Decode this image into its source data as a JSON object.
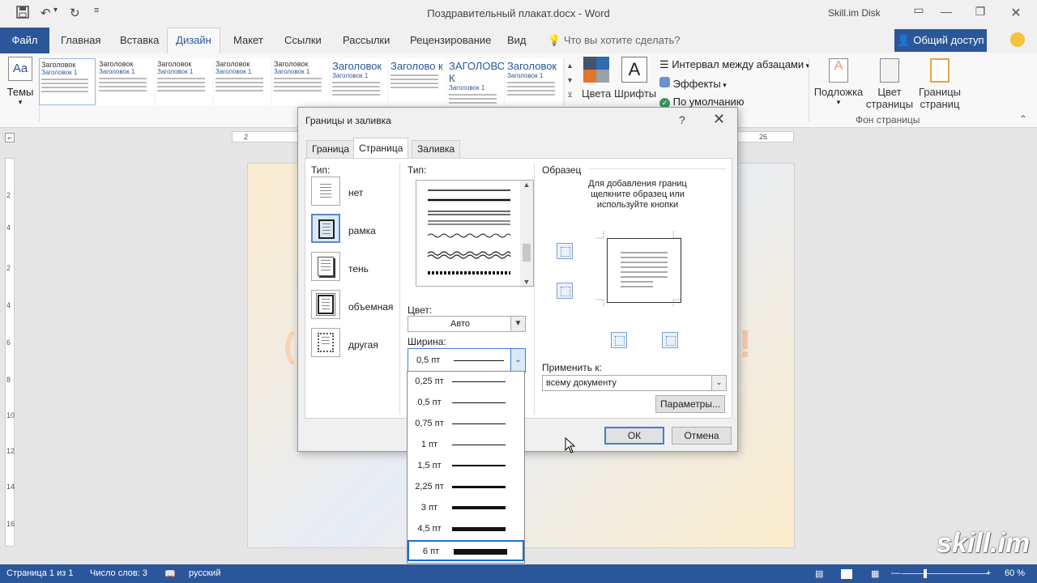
{
  "window": {
    "doc_title": "Поздравительный плакат.docx - Word",
    "cloud": "Skill.im Disk"
  },
  "tabs": {
    "file": "Файл",
    "home": "Главная",
    "insert": "Вставка",
    "design": "Дизайн",
    "layout": "Макет",
    "references": "Ссылки",
    "mailings": "Рассылки",
    "review": "Рецензирование",
    "view": "Вид",
    "tell_me": "Что вы хотите сделать?",
    "share": "Общий доступ"
  },
  "ribbon": {
    "themes": "Темы",
    "gallery": [
      {
        "heading": "Заголовок",
        "sub": "Заголовок 1"
      },
      {
        "heading": "Заголовок",
        "sub": "Заголовок 1"
      },
      {
        "heading": "Заголовок",
        "sub": "Заголовок 1"
      },
      {
        "heading": "Заголовок",
        "sub": "Заголовок 1"
      },
      {
        "heading": "Заголовок",
        "sub": "Заголовок 1"
      },
      {
        "heading": "Заголовок",
        "sub": "Заголовок 1"
      },
      {
        "heading": "Заголово к",
        "sub": ""
      },
      {
        "heading": "ЗАГОЛОВО К",
        "sub": "Заголовок 1"
      },
      {
        "heading": "Заголовок",
        "sub": "Заголовок 1"
      }
    ],
    "colors": "Цвета",
    "fonts": "Шрифты",
    "font_glyph": "A",
    "spacing": "Интервал между абзацами",
    "effects": "Эффекты",
    "default": "По умолчанию",
    "watermark": "Подложка",
    "page_color_1": "Цвет",
    "page_color_2": "страницы",
    "page_borders_1": "Границы",
    "page_borders_2": "страниц",
    "page_bg_group": "Фон страницы"
  },
  "ruler": {
    "left": "2",
    "right": "26",
    "vertical": [
      "2",
      "4",
      "2",
      "4",
      "6",
      "8",
      "10",
      "12",
      "14",
      "16"
    ]
  },
  "dialog": {
    "title": "Границы и заливка",
    "help": "?",
    "tabs": [
      "Граница",
      "Страница",
      "Заливка"
    ],
    "type_label": "Тип:",
    "options": [
      "нет",
      "рамка",
      "тень",
      "объемная",
      "другая"
    ],
    "style_label": "Тип:",
    "color_label": "Цвет:",
    "color_value": "Авто",
    "width_label": "Ширина:",
    "width_value": "0,5 пт",
    "preview_label": "Образец",
    "preview_hint": "Для добавления границ щелкните образец или используйте кнопки",
    "apply_label": "Применить к:",
    "apply_value": "всему документу",
    "options_button": "Параметры...",
    "ok": "ОК",
    "cancel": "Отмена"
  },
  "width_options": [
    {
      "label": "0,25 пт",
      "thickness": 0.25
    },
    {
      "label": "0,5 пт",
      "thickness": 0.5
    },
    {
      "label": "0,75 пт",
      "thickness": 0.75
    },
    {
      "label": "1 пт",
      "thickness": 1
    },
    {
      "label": "1,5 пт",
      "thickness": 1.5
    },
    {
      "label": "2,25 пт",
      "thickness": 2.25
    },
    {
      "label": "3 пт",
      "thickness": 3
    },
    {
      "label": "4,5 пт",
      "thickness": 4.5
    },
    {
      "label": "6 пт",
      "thickness": 6
    }
  ],
  "poster": {
    "left_char": "(",
    "right_char": "!"
  },
  "status": {
    "page": "Страница 1 из 1",
    "words": "Число слов: 3",
    "language": "русский",
    "zoom": "60 %"
  },
  "watermark_text": "skill.im",
  "colors": {
    "accent": "#2b579a",
    "dialog_border": "#7a9cd3"
  }
}
